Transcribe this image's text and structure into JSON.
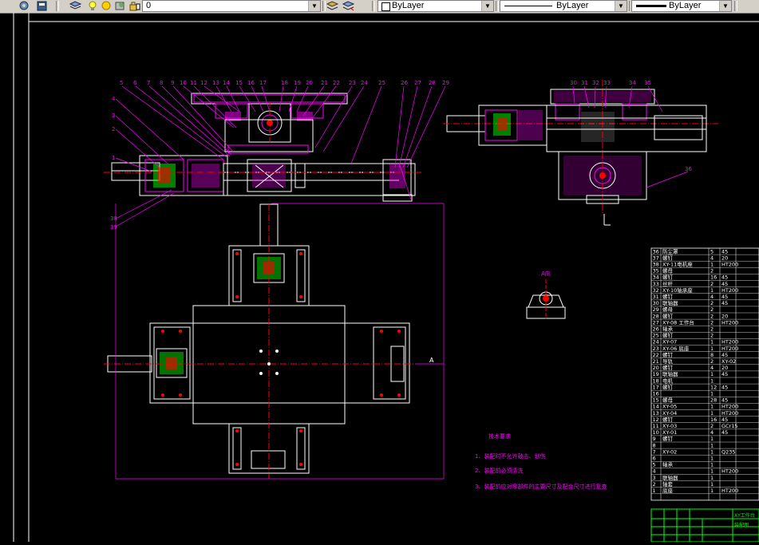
{
  "toolbar": {
    "layer_name": "0",
    "color": "ByLayer",
    "linetype": "ByLayer",
    "lineweight": "ByLayer"
  },
  "drawing": {
    "view_label": "A向",
    "section_mark": "A",
    "tech_title": "技术要求",
    "tech_notes": [
      "1、装配时不允许敲击、划伤",
      "2、装配前必须清洗",
      "3、装配前应对零部件的主要尺寸及配合尺寸进行复查"
    ],
    "callouts_top": [
      "5",
      "6",
      "7",
      "8",
      "9",
      "10",
      "11",
      "12",
      "13",
      "14",
      "15",
      "16",
      "17",
      "18",
      "19",
      "20",
      "21",
      "22",
      "23",
      "24",
      "25",
      "26",
      "27",
      "28",
      "29"
    ],
    "callouts_right": [
      "30",
      "31",
      "32",
      "33",
      "34",
      "35"
    ],
    "callouts_left": [
      "4",
      "3",
      "2",
      "1"
    ],
    "callouts_bottom_left": [
      "38",
      "39"
    ],
    "callout_right_side": "36"
  },
  "bom": {
    "rows": [
      {
        "n": "36",
        "name": "防尘罩",
        "qty": "5",
        "mat": "45"
      },
      {
        "n": "37",
        "name": "螺钉",
        "qty": "4",
        "mat": "20"
      },
      {
        "n": "38",
        "name": "XY-11电机座",
        "qty": "1",
        "mat": "HT200"
      },
      {
        "n": "35",
        "name": "螺母",
        "qty": "2",
        "mat": ""
      },
      {
        "n": "34",
        "name": "螺钉",
        "qty": "16",
        "mat": "45"
      },
      {
        "n": "33",
        "name": "丝杆",
        "qty": "2",
        "mat": "45"
      },
      {
        "n": "32",
        "name": "XY-10轴承座",
        "qty": "1",
        "mat": "HT200"
      },
      {
        "n": "31",
        "name": "螺钉",
        "qty": "4",
        "mat": "45"
      },
      {
        "n": "30",
        "name": "联轴器",
        "qty": "2",
        "mat": "45"
      },
      {
        "n": "29",
        "name": "螺母",
        "qty": "2",
        "mat": ""
      },
      {
        "n": "28",
        "name": "螺钉",
        "qty": "2",
        "mat": "20"
      },
      {
        "n": "27",
        "name": "XY-08 工作台",
        "qty": "2",
        "mat": "HT200"
      },
      {
        "n": "26",
        "name": "轴承",
        "qty": "2",
        "mat": ""
      },
      {
        "n": "25",
        "name": "螺钉",
        "qty": "2",
        "mat": ""
      },
      {
        "n": "24",
        "name": "XY-07",
        "qty": "1",
        "mat": "HT200"
      },
      {
        "n": "23",
        "name": "XY-06 底座",
        "qty": "1",
        "mat": "HT200"
      },
      {
        "n": "22",
        "name": "螺钉",
        "qty": "8",
        "mat": "45"
      },
      {
        "n": "21",
        "name": "导轨",
        "qty": "2",
        "mat": "XY-02"
      },
      {
        "n": "20",
        "name": "螺钉",
        "qty": "4",
        "mat": "20"
      },
      {
        "n": "19",
        "name": "联轴器",
        "qty": "1",
        "mat": "45"
      },
      {
        "n": "18",
        "name": "电机",
        "qty": "1",
        "mat": ""
      },
      {
        "n": "17",
        "name": "螺钉",
        "qty": "12",
        "mat": "45"
      },
      {
        "n": "16",
        "name": "",
        "qty": "1",
        "mat": ""
      },
      {
        "n": "15",
        "name": "螺母",
        "qty": "28",
        "mat": "45"
      },
      {
        "n": "14",
        "name": "XY-05",
        "qty": "1",
        "mat": "HT200"
      },
      {
        "n": "13",
        "name": "XY-04",
        "qty": "1",
        "mat": "HT200"
      },
      {
        "n": "12",
        "name": "螺钉",
        "qty": "16",
        "mat": "45"
      },
      {
        "n": "11",
        "name": "XY-03",
        "qty": "2",
        "mat": "GCr15"
      },
      {
        "n": "10",
        "name": "XY-01",
        "qty": "4",
        "mat": "45"
      },
      {
        "n": "9",
        "name": "螺钉",
        "qty": "1",
        "mat": ""
      },
      {
        "n": "8",
        "name": "",
        "qty": "1",
        "mat": ""
      },
      {
        "n": "7",
        "name": "XY-02",
        "qty": "1",
        "mat": "Q235"
      },
      {
        "n": "6",
        "name": "",
        "qty": "1",
        "mat": ""
      },
      {
        "n": "5",
        "name": "轴承",
        "qty": "1",
        "mat": ""
      },
      {
        "n": "4",
        "name": "",
        "qty": "1",
        "mat": "HT200"
      },
      {
        "n": "3",
        "name": "联轴器",
        "qty": "1",
        "mat": ""
      },
      {
        "n": "2",
        "name": "轴套",
        "qty": "1",
        "mat": ""
      },
      {
        "n": "1",
        "name": "底座",
        "qty": "1",
        "mat": "HT200"
      }
    ],
    "title_block_name": "XY工作台",
    "title_block_sub": "装配图"
  },
  "colors": {
    "magenta": "#ff00ff",
    "white": "#ffffff",
    "red": "#ff0000",
    "green": "#00ff00",
    "cyan": "#00ffff",
    "yellow": "#ffff00",
    "background": "#000000"
  }
}
